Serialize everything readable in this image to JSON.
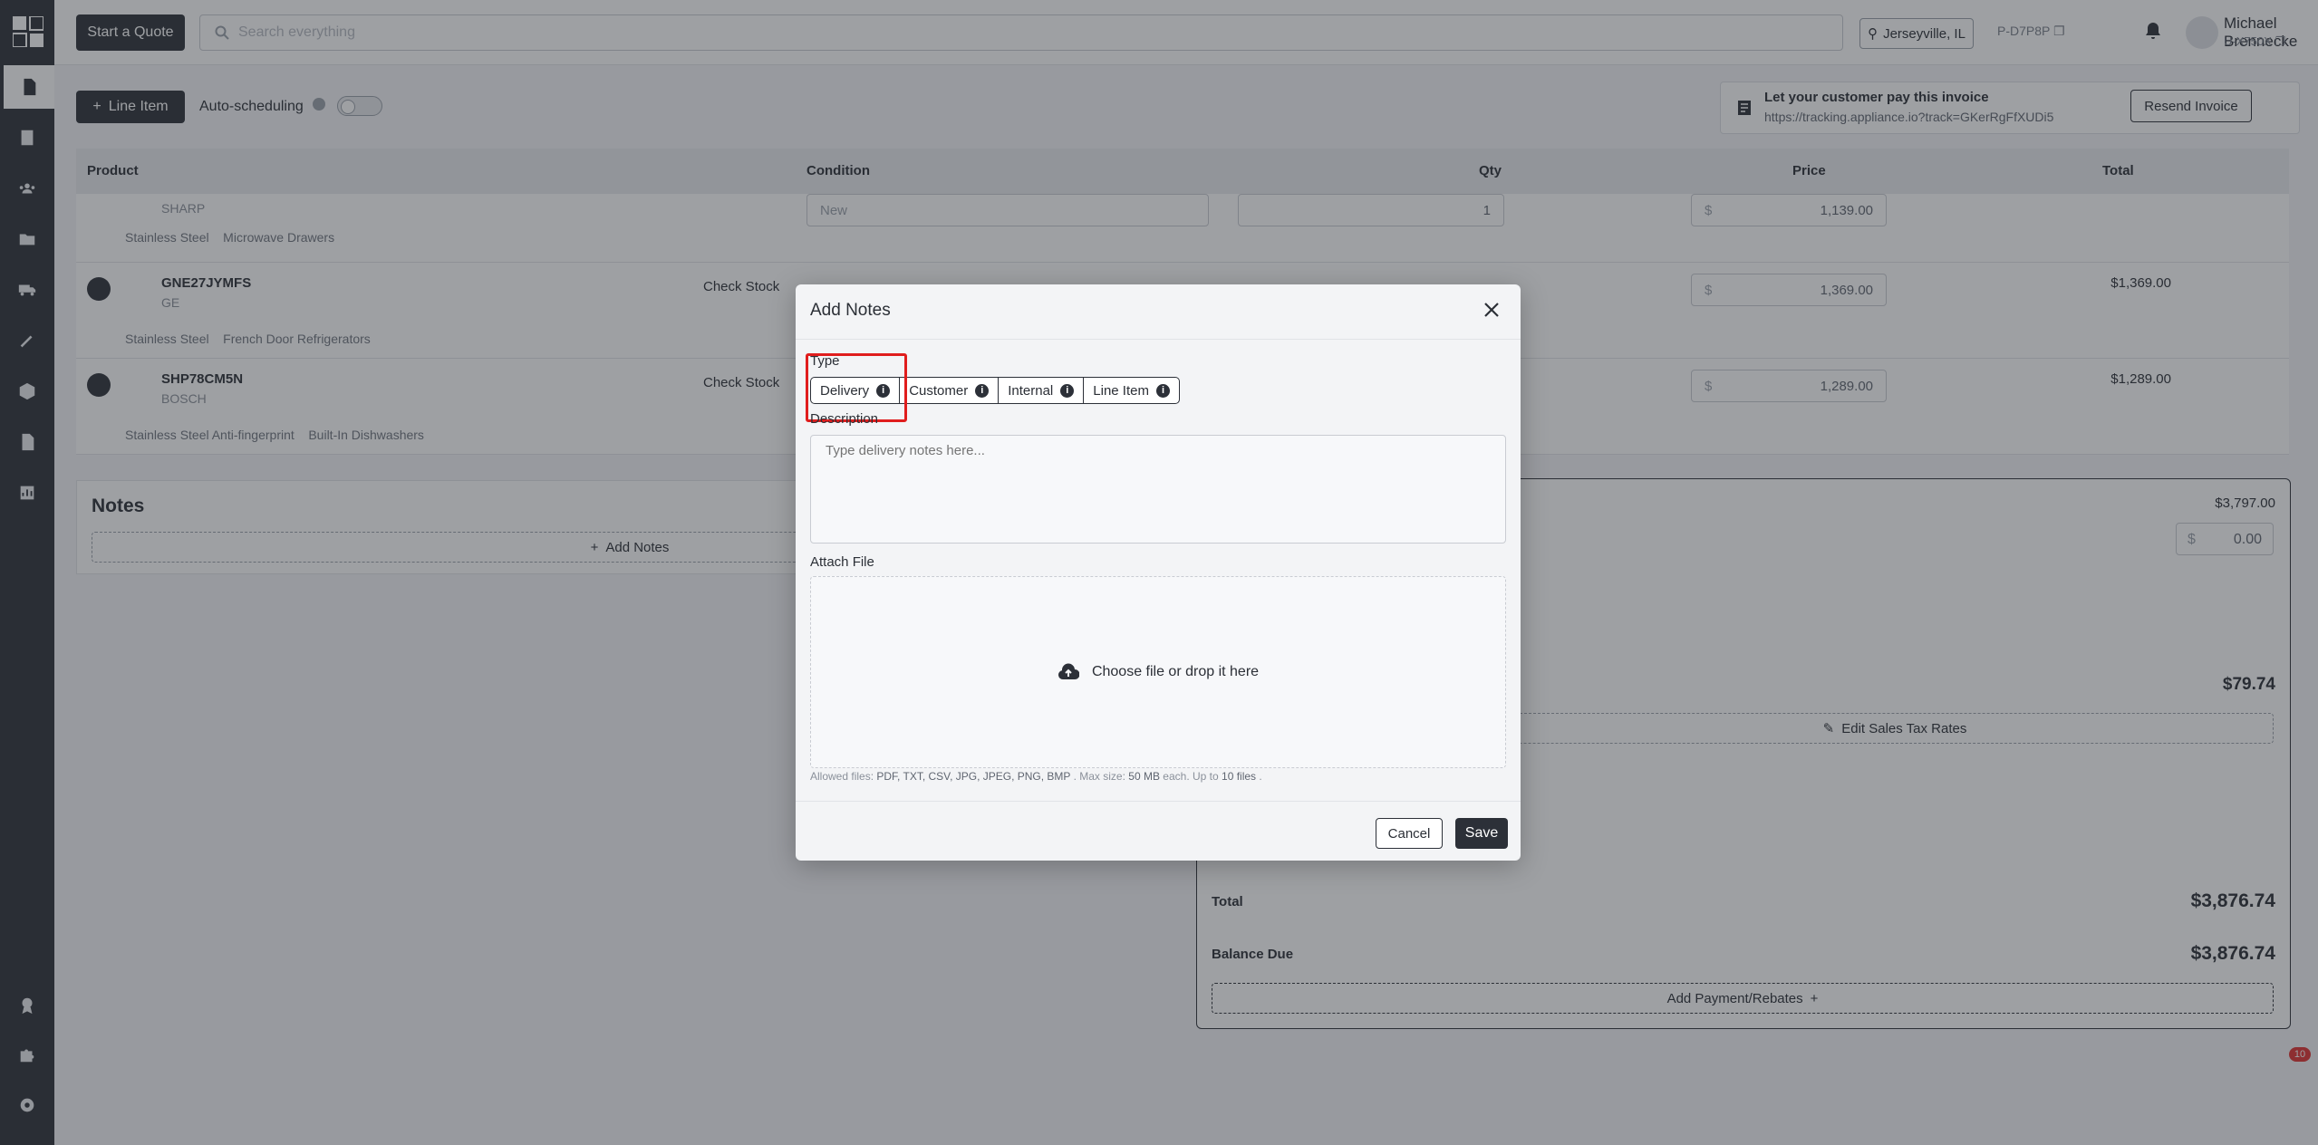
{
  "topbar": {
    "start_quote": "Start a Quote",
    "search_placeholder": "Search everything",
    "location": "Jerseyville, IL",
    "project_id": "P-D7P8P",
    "user_name": "Michael Brennecke",
    "user_id": "U-X750X"
  },
  "toolbar": {
    "line_item": "Line Item",
    "auto_scheduling": "Auto-scheduling"
  },
  "payment": {
    "title": "Let your customer pay this invoice",
    "link": "https://tracking.appliance.io?track=GKerRgFfXUDi5",
    "resend": "Resend Invoice"
  },
  "table": {
    "headers": [
      "Product",
      "Condition",
      "Qty",
      "Price",
      "Total"
    ],
    "rows": [
      {
        "model": "",
        "brand": "SHARP",
        "finish": "Stainless Steel",
        "category": "Microwave Drawers",
        "condition": "New",
        "qty": "1",
        "price": "1,139.00",
        "total": ""
      },
      {
        "model": "GNE27JYMFS",
        "brand": "GE",
        "finish": "Stainless Steel",
        "category": "French Door Refrigerators",
        "check": "Check Stock",
        "price": "1,369.00",
        "total": "$1,369.00"
      },
      {
        "model": "SHP78CM5N",
        "brand": "BOSCH",
        "finish": "Stainless Steel Anti-fingerprint",
        "category": "Built-In Dishwashers",
        "check": "Check Stock",
        "price": "1,289.00",
        "total": "$1,289.00"
      }
    ],
    "currency": "$"
  },
  "notes": {
    "title": "Notes",
    "add_notes": "Add Notes"
  },
  "summary": {
    "subtotal": "$3,797.00",
    "discount": "0.00",
    "tax": "$79.74",
    "edit_tax": "Edit Sales Tax Rates",
    "total_label": "Total",
    "total": "$3,876.74",
    "balance_label": "Balance Due",
    "balance": "$3,876.74",
    "add_payment": "Add Payment/Rebates"
  },
  "badge": "10",
  "modal": {
    "title": "Add Notes",
    "type_label": "Type",
    "types": [
      "Delivery",
      "Customer",
      "Internal",
      "Line Item"
    ],
    "description_label": "Description",
    "description_placeholder": "Type delivery notes here...",
    "attach_label": "Attach File",
    "dropzone_text": "Choose file or drop it here",
    "allowed_prefix": "Allowed files:",
    "allowed_types": "PDF, TXT, CSV, JPG, JPEG, PNG, BMP",
    "max_prefix": ". Max size:",
    "max_size": "50 MB",
    "each_prefix": "each. Up to",
    "max_files": "10 files",
    "cancel": "Cancel",
    "save": "Save"
  }
}
